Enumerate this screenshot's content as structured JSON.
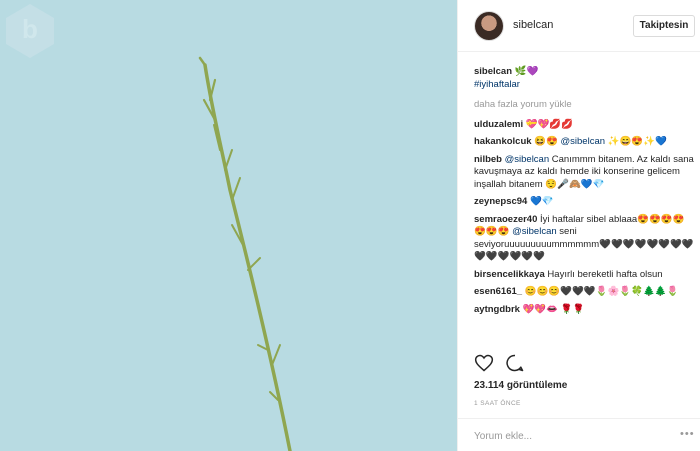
{
  "header": {
    "username": "sibelcan",
    "follow_label": "Takiptesin"
  },
  "caption": {
    "username": "sibelcan",
    "emoji": "🌿💜",
    "hashtag": "#iyihaftalar"
  },
  "load_more": "daha fazla yorum yükle",
  "comments": [
    {
      "user": "ulduzalemi",
      "text": "💝💖💋💋"
    },
    {
      "user": "hakankolcuk",
      "pre": "😆😍",
      "mention": "@sibelcan",
      "text": "✨😄😍✨💙"
    },
    {
      "user": "nilbeb",
      "mention": "@sibelcan",
      "text": "Canımmm bitanem. Az kaldı sana kavuşmaya az kaldı hemde iki konserine gelicem inşallah bitanem 😌🎤🙈💙💎"
    },
    {
      "user": "zeynepsc94",
      "text": "💙💎"
    },
    {
      "user": "semraoezer40",
      "text": "İyi haftalar sibel ablaaa😍😍😍😍😍😍😍",
      "mention": "@sibelcan",
      "text2": "seni seviyoruuuuuuuuummmmmm🖤🖤🖤🖤🖤🖤🖤🖤🖤🖤🖤🖤🖤🖤"
    },
    {
      "user": "birsencelikkaya",
      "text": "Hayırlı bereketli hafta olsun"
    },
    {
      "user": "esen6161_",
      "text": "😊😊😊🖤🖤🖤🌷🌸🌷🍀🌲🌲🌷"
    },
    {
      "user": "aytngdbrk",
      "text": "💖💖👄 🌹🌹"
    }
  ],
  "views": "23.114 görüntüleme",
  "time_ago": "1 SAAT ÖNCE",
  "comment_placeholder": "Yorum ekle...",
  "more_dots": "•••",
  "colors": {
    "photo_bg": "#b8dbe2",
    "stem": "#8fa650",
    "mention": "#003569"
  },
  "icons": [
    "heart-icon",
    "comment-icon",
    "more-options-icon",
    "watermark-icon"
  ]
}
